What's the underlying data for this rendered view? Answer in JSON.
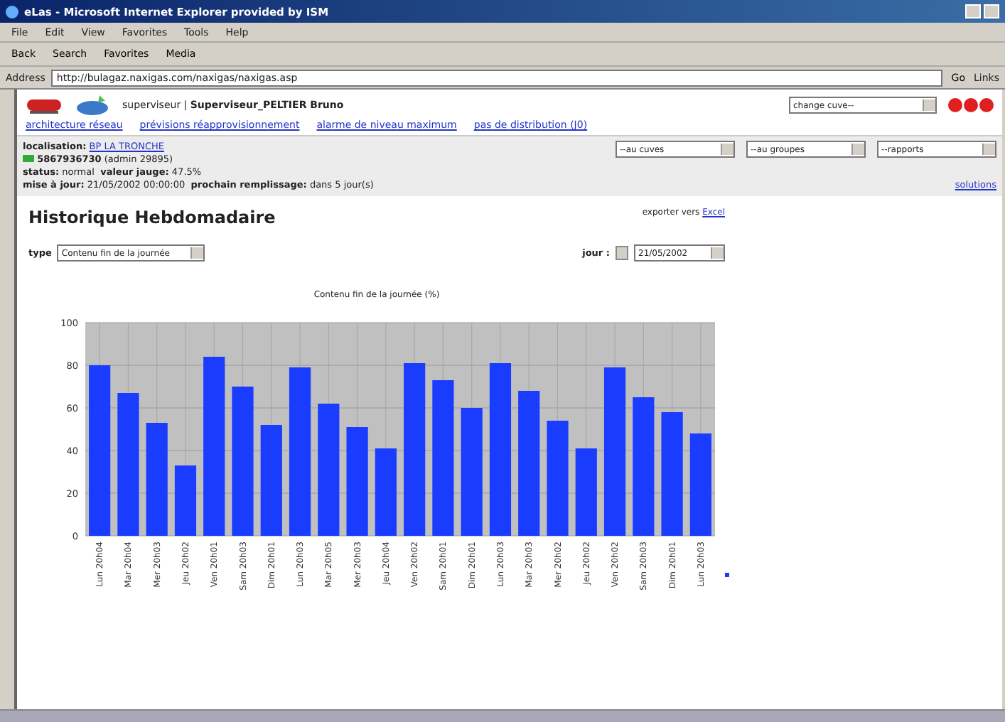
{
  "window": {
    "title": "eLas - Microsoft Internet Explorer provided by ISM"
  },
  "menu": [
    "File",
    "Edit",
    "View",
    "Favorites",
    "Tools",
    "Help"
  ],
  "toolbar": [
    "Back",
    "Search",
    "Favorites",
    "Media"
  ],
  "address": {
    "label": "Address",
    "value": "http://bulagaz.naxigas.com/naxigas/naxigas.asp",
    "go": "Go",
    "links": "Links"
  },
  "header": {
    "role": "superviseur",
    "separator": "|",
    "user": "Superviseur_PELTIER Bruno",
    "cuve_select": "change cuve--",
    "links": [
      "architecture réseau",
      "prévisions réapprovisionnement",
      "alarme de niveau maximum",
      "pas de distribution (J0)"
    ]
  },
  "info": {
    "localisation_label": "localisation:",
    "localisation": "BP LA TRONCHE",
    "tank_id": "5867936730",
    "tank_note": "(admin 29895)",
    "status_label": "status:",
    "status": "normal",
    "jauge_label": "valeur jauge:",
    "jauge": "47.5%",
    "maj_label": "mise à jour:",
    "maj": "21/05/2002 00:00:00",
    "remplissage_label": "prochain remplissage:",
    "remplissage": "dans 5 jour(s)",
    "selects": [
      "--au cuves",
      "--au groupes",
      "--rapports"
    ],
    "help_link": "solutions"
  },
  "page": {
    "title": "Historique Hebdomadaire",
    "export_label": "exporter vers",
    "export_link": "Excel",
    "type_label": "type",
    "type_value": "Contenu fin de la journée",
    "jour_label": "jour :",
    "jour_value": "21/05/2002"
  },
  "chart_data": {
    "type": "bar",
    "grid": true,
    "title": "Contenu fin de la journée (%)",
    "ylim": [
      0,
      100
    ],
    "yticks": [
      0,
      20,
      40,
      60,
      80,
      100
    ],
    "categories": [
      "Lun 20h04",
      "Mar 20h04",
      "Mer 20h03",
      "Jeu 20h02",
      "Ven 20h01",
      "Sam 20h03",
      "Dim 20h01",
      "Lun 20h03",
      "Mar 20h05",
      "Mer 20h03",
      "Jeu 20h04",
      "Ven 20h02",
      "Sam 20h01",
      "Dim 20h01",
      "Lun 20h03",
      "Mar 20h03",
      "Mer 20h02",
      "Jeu 20h02",
      "Ven 20h02",
      "Sam 20h03",
      "Dim 20h01",
      "Lun 20h03"
    ],
    "series": [
      {
        "color": "#1a3cff",
        "values": [
          80,
          67,
          53,
          33,
          84,
          70,
          52,
          79,
          62,
          51,
          41,
          81,
          73,
          60,
          81,
          68,
          54,
          41,
          79,
          65,
          58,
          48
        ]
      }
    ]
  }
}
